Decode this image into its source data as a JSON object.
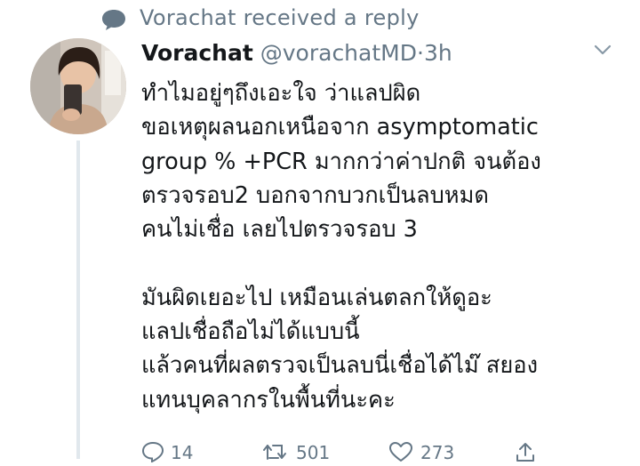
{
  "context": {
    "icon": "speech-bubble-icon",
    "text": "Vorachat received a reply"
  },
  "tweet": {
    "display_name": "Vorachat",
    "handle": "@vorachatMD",
    "separator": "·",
    "time": "3h",
    "lines": [
      "ทำไมอยู่ๆถึงเอะใจ ว่าแลปผิด",
      "ขอเหตุผลนอกเหนือจาก asymptomatic",
      "group % +PCR มากกว่าค่าปกติ จนต้อง",
      "ตรวจรอบ2 บอกจากบวกเป็นลบหมด",
      "คนไม่เชื่อ เลยไปตรวจรอบ 3",
      "",
      "มันผิดเยอะไป เหมือนเล่นตลกให้ดูอะ",
      "แลปเชื่อถือไม่ได้แบบนี้",
      "แล้วคนที่ผลตรวจเป็นลบนี่เชื่อได้ไม๊ สยอง",
      "แทนบุคลากรในพื้นที่นะคะ"
    ]
  },
  "actions": {
    "reply_count": "14",
    "retweet_count": "501",
    "like_count": "273"
  },
  "colors": {
    "text": "#14171a",
    "muted": "#657786",
    "thread_line": "#e1e8ed"
  }
}
